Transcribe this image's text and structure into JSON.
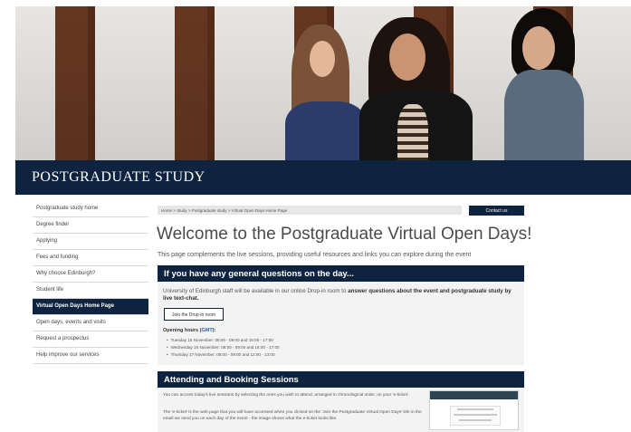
{
  "header": {
    "title": "POSTGRADUATE STUDY"
  },
  "leftnav": {
    "items": [
      {
        "label": "Postgraduate study home"
      },
      {
        "label": "Degree finder"
      },
      {
        "label": "Applying"
      },
      {
        "label": "Fees and funding"
      },
      {
        "label": "Why choose Edinburgh?"
      },
      {
        "label": "Student life"
      },
      {
        "label": "Virtual Open Days Home Page",
        "active": true
      },
      {
        "label": "Open days, events and visits"
      },
      {
        "label": "Request a prospectus"
      },
      {
        "label": "Help improve our services"
      }
    ]
  },
  "breadcrumb": "Home > Study > Postgraduate study > Virtual Open Days Home Page",
  "contact_button": "Contact us",
  "main": {
    "heading": "Welcome to the Postgraduate Virtual Open Days!",
    "intro": "This page complements the live sessions, providing useful resources and links you can explore during the event"
  },
  "section1": {
    "title": "If you have any general questions on the day...",
    "text_prefix": "University of Edinburgh staff will be available in our online Drop-in room to ",
    "text_bold": "answer questions about the event and postgraduate study by live text-chat.",
    "button": "Join the Drop-in room",
    "hours_label": "Opening hours (",
    "hours_tz": "GMT",
    "hours_close": "):",
    "hours": [
      "Tuesday 15 November: 08:00 - 09:00 and 15:00 - 17:00",
      "Wednesday 16 November: 08:00 - 09:00 and 16:00 - 17:00",
      "Thursday 17 November: 08:00 - 09:00 and 12:00 - 13:00"
    ]
  },
  "section2": {
    "title": "Attending and Booking Sessions",
    "para1": "You can access today's live sessions by selecting the ones you wish to attend, arranged in chronological order, on your 'e-ticket'.",
    "para2": "The 'e-ticket' is the web page that you will have accessed when you clicked on the 'Join the Postgraduate Virtual Open Days' link in the email we send you on each day of the event - the image shows what the e-ticket looks like."
  }
}
